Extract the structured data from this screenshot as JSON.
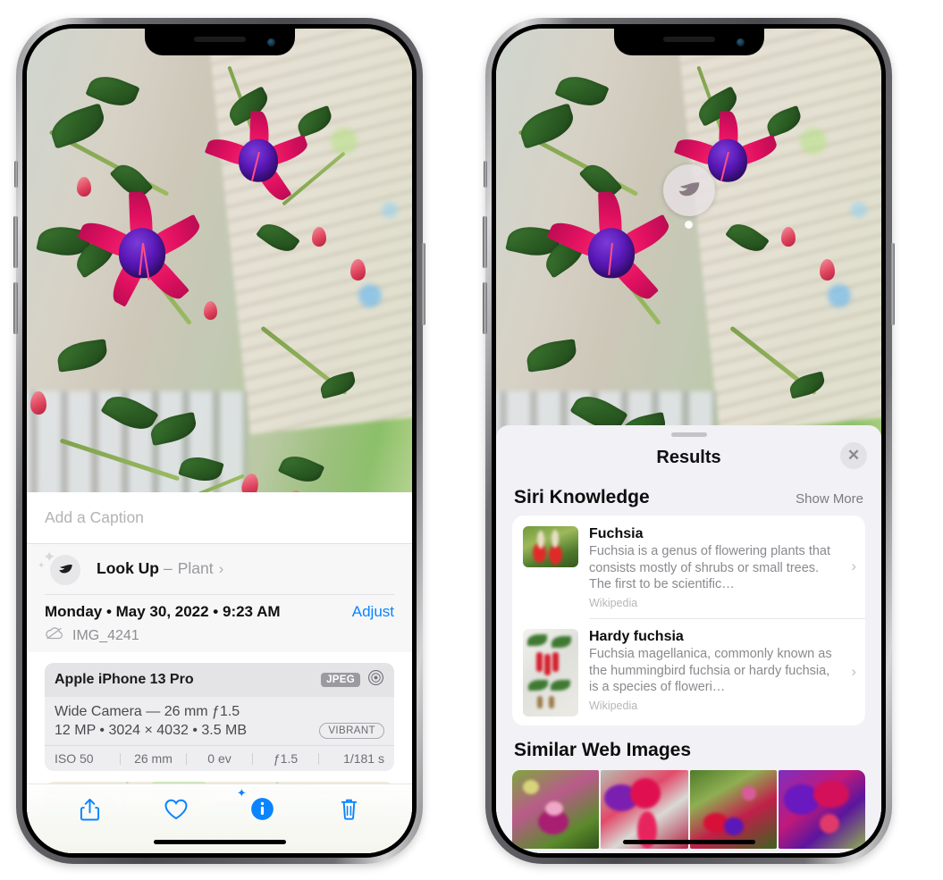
{
  "left_phone": {
    "name": "iphone-photos-info-view",
    "caption_field": {
      "placeholder": "Add a Caption",
      "value": ""
    },
    "look_up": {
      "icon": "leaf-icon",
      "sparkle_icon": "sparkles-icon",
      "label": "Look Up",
      "dash": "–",
      "subject": "Plant",
      "chevron": "›"
    },
    "meta": {
      "date": "Monday • May 30, 2022 • 9:23 AM",
      "adjust_label": "Adjust",
      "cloud_icon": "icloud-slash-icon",
      "filename": "IMG_4241"
    },
    "camera_card": {
      "model": "Apple iPhone 13 Pro",
      "format_chip": "JPEG",
      "aperture_icon": "camera-aperture-icon",
      "lens_line": "Wide Camera — 26 mm ƒ1.5",
      "specs_line": "12 MP • 3024 × 4032 • 3.5 MB",
      "style_chip": "VIBRANT",
      "exif": [
        "ISO 50",
        "26 mm",
        "0 ev",
        "ƒ1.5",
        "1/181 s"
      ]
    },
    "map": {
      "name": "location-map-preview",
      "pin_label": "photo-thumbnail-pin"
    },
    "toolbar": [
      {
        "name": "share-button",
        "icon": "share-icon"
      },
      {
        "name": "favorite-button",
        "icon": "heart-icon"
      },
      {
        "name": "info-button",
        "icon": "info-sparkle-icon"
      },
      {
        "name": "delete-button",
        "icon": "trash-icon"
      }
    ]
  },
  "right_phone": {
    "name": "iphone-visual-lookup-results",
    "photo_badge": {
      "icon": "leaf-icon",
      "name": "visual-lookup-badge"
    },
    "sheet": {
      "grabber": "drag-handle",
      "title": "Results",
      "close_icon": "✕"
    },
    "siri_knowledge": {
      "section_title": "Siri Knowledge",
      "show_more": "Show More",
      "items": [
        {
          "title": "Fuchsia",
          "description": "Fuchsia is a genus of flowering plants that consists mostly of shrubs or small trees. The first to be scientific…",
          "source": "Wikipedia",
          "chevron": "›"
        },
        {
          "title": "Hardy fuchsia",
          "description": "Fuchsia magellanica, commonly known as the hummingbird fuchsia or hardy fuchsia, is a species of floweri…",
          "source": "Wikipedia",
          "chevron": "›"
        }
      ]
    },
    "similar_web_images": {
      "section_title": "Similar Web Images",
      "count": 4
    }
  },
  "colors": {
    "accent_blue": "#0a84ff",
    "sheet_bg": "#f1f1f6",
    "card_bg": "#ffffff",
    "secondary_text": "#8a8a8f",
    "chip_gray": "#9a9aa0"
  }
}
